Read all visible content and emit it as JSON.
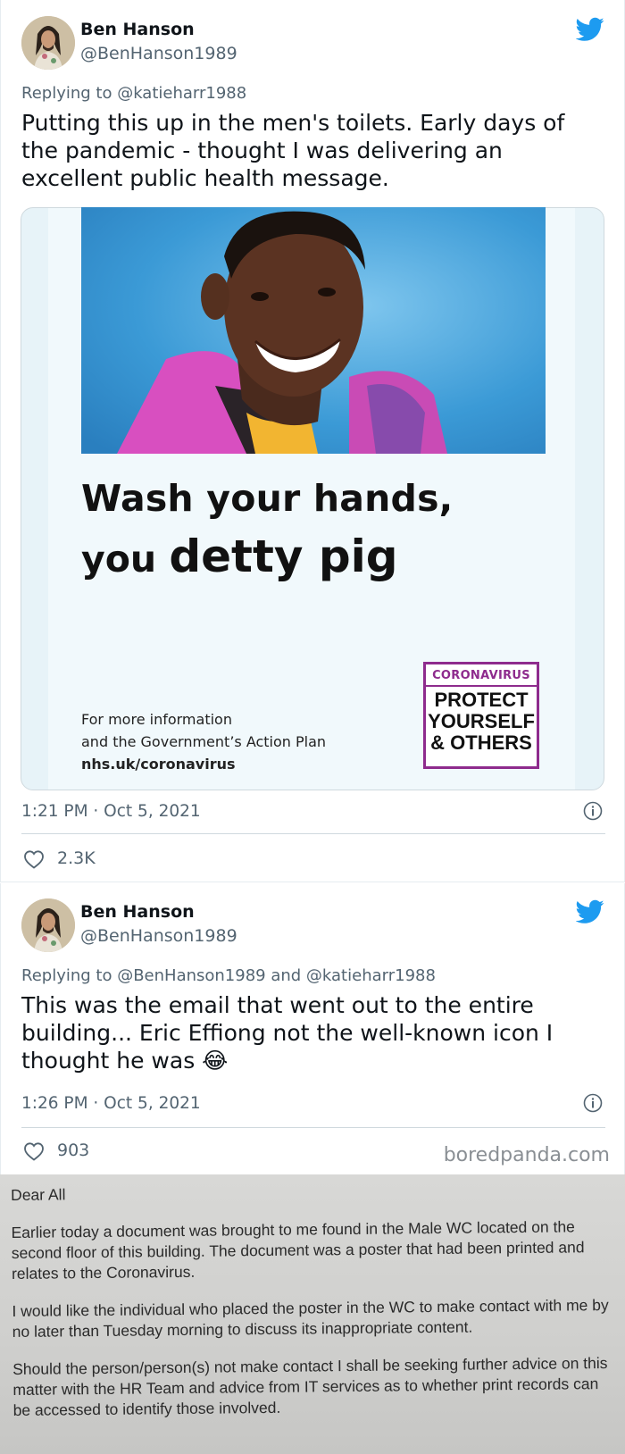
{
  "tweets": [
    {
      "author_name": "Ben Hanson",
      "author_handle": "@BenHanson1989",
      "replying_to": "Replying to @katieharr1988",
      "body_lines": [
        "Putting this up in the men's toilets. Early days of",
        "the pandemic - thought I was delivering an",
        "excellent public health message."
      ],
      "timestamp": "1:21 PM · Oct 5, 2021",
      "likes": "2.3K"
    },
    {
      "author_name": "Ben Hanson",
      "author_handle": "@BenHanson1989",
      "replying_to": "Replying to @BenHanson1989 and @katieharr1988",
      "body_lines": [
        "This was the email that went out to the entire",
        "building... Eric Effiong not the well-known icon I",
        "thought he was 😂"
      ],
      "timestamp": "1:26 PM · Oct 5, 2021",
      "likes": "903"
    }
  ],
  "poster": {
    "headline_line1": "Wash your hands,",
    "headline_line2_a": "you ",
    "headline_line2_b": "detty pig",
    "info_line1": "For more information",
    "info_line2": "and the Government’s Action Plan",
    "info_url": "nhs.uk/coronavirus",
    "badge_top": "CORONAVIRUS",
    "badge_line1": "PROTECT",
    "badge_line2": "YOURSELF",
    "badge_line3": "& OTHERS"
  },
  "watermark": "boredpanda.com",
  "email": {
    "greeting": "Dear All",
    "paragraph1": "Earlier today a document was brought to me found in the Male WC located on the second floor of this building. The document was a poster that had been printed and relates to the Coronavirus.",
    "paragraph2": "I would like the individual who placed the poster in the WC to make contact with me by no later than Tuesday morning to discuss its inappropriate content.",
    "paragraph3": "Should the person/person(s) not make contact I shall be seeking further advice on this matter with the HR Team and advice from IT services as to whether print records can be accessed to identify those involved."
  },
  "colors": {
    "twitter_blue": "#1d9bf0",
    "poster_purple": "#8e2b8d",
    "photo_background": "#3b9ad6",
    "jacket_pink": "#d84fc0"
  },
  "icons": [
    "twitter-bird-icon",
    "info-icon",
    "heart-icon",
    "avatar"
  ]
}
